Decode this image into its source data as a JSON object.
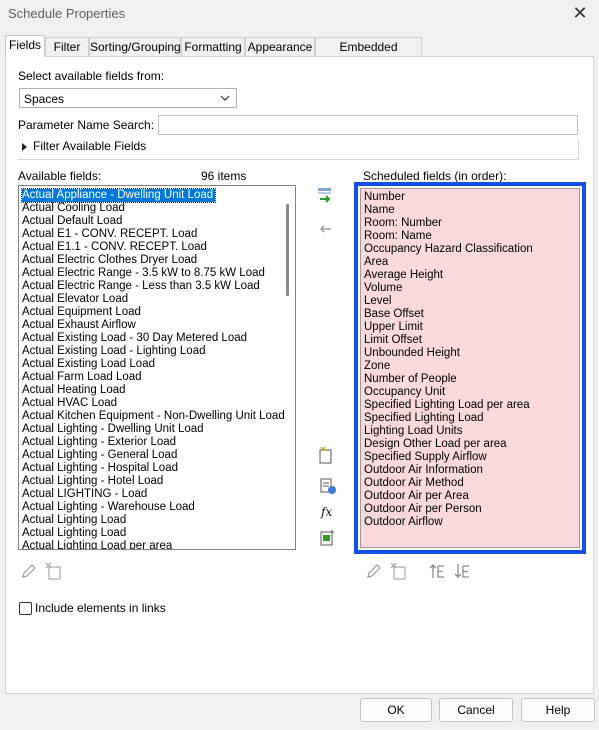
{
  "window": {
    "title": "Schedule Properties"
  },
  "tabs": [
    {
      "label": "Fields",
      "active": true
    },
    {
      "label": "Filter"
    },
    {
      "label": "Sorting/Grouping"
    },
    {
      "label": "Formatting"
    },
    {
      "label": "Appearance"
    },
    {
      "label": "Embedded Schedule"
    }
  ],
  "fields": {
    "select_from_label": "Select available fields from:",
    "category_value": "Spaces",
    "param_search_label": "Parameter Name Search:",
    "param_search_value": "",
    "filter_label": "Filter Available Fields",
    "available_label": "Available fields:",
    "available_count": "96 items",
    "scheduled_label": "Scheduled fields (in order):",
    "available_items": [
      "Actual Appliance - Dwelling Unit Load",
      "Actual Cooling Load",
      "Actual Default Load",
      "Actual E1 - CONV. RECEPT. Load",
      "Actual E1.1 - CONV. RECEPT. Load",
      "Actual Electric Clothes Dryer Load",
      "Actual Electric Range - 3.5 kW to 8.75 kW Load",
      "Actual Electric Range - Less than 3.5 kW Load",
      "Actual Elevator Load",
      "Actual Equipment Load",
      "Actual Exhaust Airflow",
      "Actual Existing Load - 30 Day Metered Load",
      "Actual Existing Load - Lighting Load",
      "Actual Existing Load Load",
      "Actual Farm Load Load",
      "Actual Heating Load",
      "Actual HVAC Load",
      "Actual Kitchen Equipment - Non-Dwelling Unit Load",
      "Actual Lighting - Dwelling Unit Load",
      "Actual Lighting - Exterior Load",
      "Actual Lighting - General Load",
      "Actual Lighting - Hospital Load",
      "Actual Lighting - Hotel Load",
      "Actual LIGHTING - Load",
      "Actual Lighting - Warehouse Load",
      "Actual Lighting Load",
      "Actual Lighting Load",
      "Actual Lighting Load per area"
    ],
    "scheduled_items": [
      "Number",
      "Name",
      "Room: Number",
      "Room: Name",
      "Occupancy Hazard Classification",
      "Area",
      "Average Height",
      "Volume",
      "Level",
      "Base Offset",
      "Upper Limit",
      "Limit Offset",
      "Unbounded Height",
      "Zone",
      "Number of People",
      "Occupancy Unit",
      "Specified Lighting Load per area",
      "Specified Lighting Load",
      "Lighting Load Units",
      "Design Other Load per area",
      "Specified Supply Airflow",
      "Outdoor Air Information",
      "Outdoor Air Method",
      "Outdoor Air per Area",
      "Outdoor Air per Person",
      "Outdoor Airflow"
    ],
    "include_links_label": "Include elements in links",
    "include_links_checked": false
  },
  "buttons": {
    "ok": "OK",
    "cancel": "Cancel",
    "help": "Help"
  },
  "colors": {
    "selection": "#0078d7",
    "highlight_border": "#1450e6",
    "scheduled_bg": "#f9d9dc"
  }
}
